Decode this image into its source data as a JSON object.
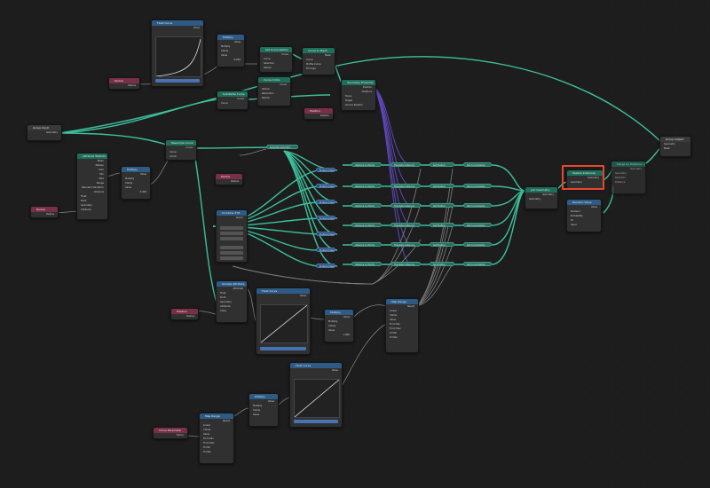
{
  "app": {
    "editor": "Geometry Node Editor"
  },
  "colors": {
    "background": "#1d1d1d",
    "geometry_wire": "#3fc9a2",
    "vector_wire": "#6b4fd8",
    "float_wire": "#9a9a9a",
    "highlight": "#e8472f"
  },
  "nodes": {
    "group_input": {
      "title": "Group Input",
      "socket": "Geometry"
    },
    "group_output": {
      "title": "Group Output",
      "sockets": [
        "Geometry",
        "Mesh"
      ]
    },
    "float_curve_top": {
      "title": "Float Curve",
      "value_label": "Value",
      "footer": "Value"
    },
    "radius_top": {
      "title": "Radius",
      "socket": "Radius"
    },
    "multiply_top": {
      "title": "Multiply",
      "out": "Value",
      "mode": "Multiply",
      "clamp": "Clamp",
      "value_label": "Value",
      "value": "0.200"
    },
    "set_curve_radius": {
      "title": "Set Curve Radius",
      "out": "Curve",
      "sockets": [
        "Curve",
        "Selection",
        "Radius"
      ]
    },
    "curve_to_mesh": {
      "title": "Curve to Mesh",
      "out": "Mesh",
      "sockets": [
        "Curve",
        "Profile Curve",
        "Fill Caps"
      ]
    },
    "curve_circle": {
      "title": "Curve Circle",
      "out": "Curve",
      "mode": "Radius",
      "resolution_label": "Resolution",
      "resolution": "8",
      "radius_label": "Radius",
      "radius": "0 m"
    },
    "subdivide_curve": {
      "title": "Subdivide Curve",
      "out": "Curve",
      "sockets": [
        "Curve",
        "Cuts"
      ]
    },
    "position_top": {
      "title": "Position",
      "socket": "Position"
    },
    "geometry_proximity": {
      "title": "Geometry Proximity",
      "out": "Position",
      "dist": "Distance",
      "mode": "Faces",
      "sockets": [
        "Target",
        "Source Position"
      ]
    },
    "attribute_statistic": {
      "title": "Attribute Statistic",
      "outputs": [
        "Mean",
        "Median",
        "Sum",
        "Min",
        "Max",
        "Range",
        "Standard Deviation",
        "Variance"
      ],
      "mode_a": "Float",
      "mode_b": "Point",
      "inputs": [
        "Geometry",
        "Attribute"
      ]
    },
    "multiply_mid": {
      "title": "Multiply",
      "out": "Value",
      "mode": "Multiply",
      "clamp": "Clamp",
      "value_label": "Value",
      "value": "0.400"
    },
    "radius_left": {
      "title": "Radius",
      "socket": "Radius"
    },
    "radius_mid": {
      "title": "Radius",
      "socket": "Radius"
    },
    "resample_curve": {
      "title": "Resample Curve",
      "out": "Curve",
      "sockets": [
        "Curve",
        "Count"
      ]
    },
    "separate_geometry": {
      "title": "Separate Geometry"
    },
    "combine_xyz": {
      "title": "Combine XYZ",
      "out": "Vector",
      "labels": [
        "X",
        "Y",
        "Z"
      ]
    },
    "attr_mid": {
      "title": "Sample Attribute",
      "out": "Attribute",
      "rows": [
        "Float",
        "Point",
        "Geometry",
        "Attribute",
        "Index"
      ]
    },
    "float_curve_mid": {
      "title": "Float Curve",
      "value_label": "Value",
      "footer": "Value"
    },
    "multiply_low": {
      "title": "Multiply",
      "out": "Value",
      "mode": "Multiply",
      "clamp": "Clamp",
      "value_label": "Value",
      "value": "1.000"
    },
    "position_low": {
      "title": "Position",
      "socket": "Radius"
    },
    "map_range_mid": {
      "title": "Map Range",
      "out": "Result",
      "mode": "Linear",
      "clamp": "Clamp",
      "rows": [
        "Value",
        "From Min",
        "From Max",
        "To Min",
        "To Max"
      ]
    },
    "float_curve_bottom": {
      "title": "Float Curve",
      "value_label": "Value",
      "footer": "Value"
    },
    "multiply_bottom": {
      "title": "Multiply",
      "out": "Value",
      "mode": "Multiply",
      "clamp": "Clamp",
      "value_label": "Value"
    },
    "map_range_bottom": {
      "title": "Map Range",
      "out": "Result",
      "mode": "Linear",
      "clamp": "Clamp",
      "rows": [
        "Value",
        "From Min",
        "From Max",
        "To Min",
        "To Max"
      ]
    },
    "curve_parameter": {
      "title": "Curve Parameter",
      "socket": "Factor"
    },
    "join_geometry": {
      "title": "Join Geometry",
      "socket": "Geometry"
    },
    "realize_instances": {
      "title": "Realize Instances",
      "socket": "Geometry"
    },
    "merge_by_distance": {
      "title": "Merge by Distance",
      "out": "Geometry",
      "sockets": [
        "Geometry",
        "Selection",
        "Distance"
      ]
    },
    "random_value": {
      "title": "Random Value",
      "out": "Value",
      "mode": "Boolean",
      "rows": [
        "Probability",
        "ID",
        "Seed"
      ]
    },
    "chain": {
      "col1": "Instance on Points",
      "col2": "Translate Instances",
      "col3": "Set Position",
      "col4": "Set Curve Radius",
      "left": "Endpoint Selection"
    }
  }
}
